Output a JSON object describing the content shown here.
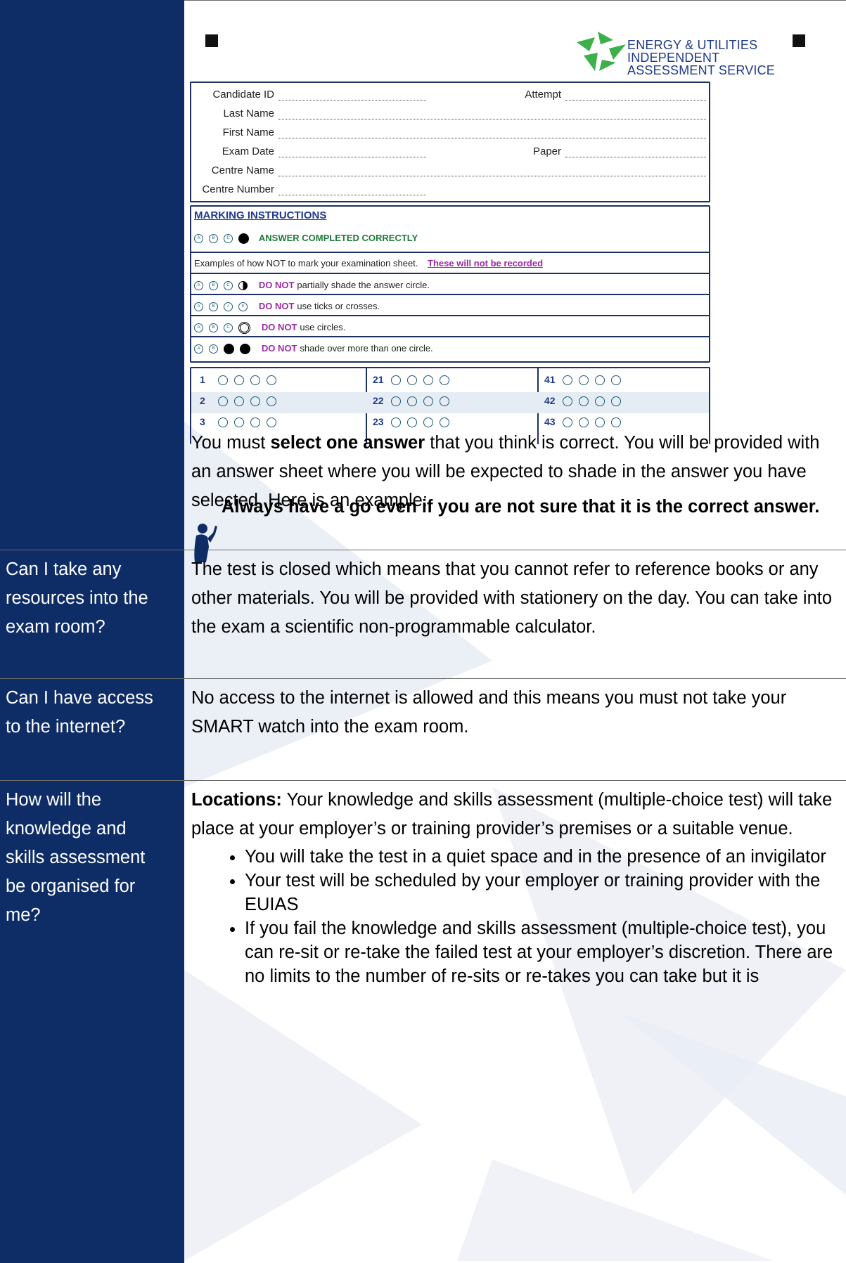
{
  "form": {
    "logo_line1": "ENERGY & UTILITIES",
    "logo_line2": "INDEPENDENT",
    "logo_line3": "ASSESSMENT SERVICE",
    "candidate_id_label": "Candidate ID",
    "attempt_label": "Attempt",
    "last_name_label": "Last Name",
    "first_name_label": "First Name",
    "exam_date_label": "Exam Date",
    "paper_label": "Paper",
    "centre_name_label": "Centre Name",
    "centre_number_label": "Centre Number",
    "marking_title": "MARKING INSTRUCTIONS",
    "correct_label": "ANSWER COMPLETED CORRECTLY",
    "examples_text": "Examples of how NOT to mark your examination sheet.",
    "not_recorded": "These will not be recorded",
    "do_not": "DO NOT",
    "rule1": "partially shade the answer circle.",
    "rule2": "use ticks or crosses.",
    "rule3": "use circles.",
    "rule4": "shade over more than one circle.",
    "question_numbers": [
      "1",
      "2",
      "3",
      "21",
      "22",
      "23",
      "41",
      "42",
      "43"
    ]
  },
  "row1": {
    "text_part1": "You must ",
    "text_bold": "select one answer",
    "text_part2": " that you think is correct. You will be provided with an answer sheet where you will be expected to shade in the answer you have selected. Here is an example:",
    "tip": "Always have a go even if you are not sure that it is the correct answer."
  },
  "row2": {
    "question": "Can I take any resources into the exam room?",
    "answer": "The test is closed which means that you cannot refer to reference books or any other materials. You will be provided with stationery on the day. You can take into the exam a scientific non-programmable calculator."
  },
  "row3": {
    "question": "Can I have access to the internet?",
    "answer": "No access to the internet is allowed and this means you must not take your SMART watch into the exam room."
  },
  "row4": {
    "question": "How will the knowledge and skills assessment be organised for me?",
    "lead_bold": "Locations:",
    "lead_text": " Your knowledge and skills assessment (multiple-choice test) will take place at your employer’s or training provider’s premises or a suitable venue.",
    "bullets": [
      "You will take the test in a quiet space and in the presence of an invigilator",
      "Your test will be scheduled by your employer or training provider with the EUIAS",
      "If you fail the knowledge and skills assessment (multiple-choice test), you can re-sit or re-take the failed test at your employer’s discretion. There are no limits to the number of re-sits or re-takes you can take but it is"
    ]
  },
  "colors": {
    "left_column": "#0e2c66",
    "form_border": "#1e3060",
    "do_not": "#9c2aa6",
    "logo_green": "#3db04a"
  }
}
